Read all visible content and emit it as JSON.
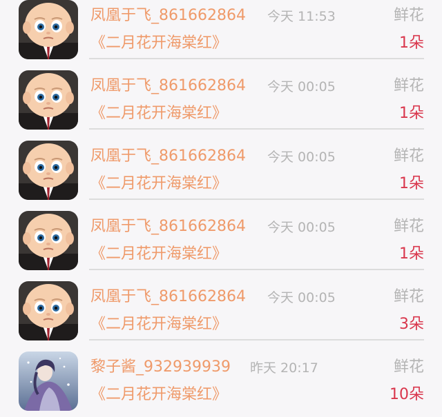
{
  "records": [
    {
      "avatar": "boss-baby-avatar",
      "user": "凤凰于飞_861662864",
      "time": "今天 11:53",
      "type": "鲜花",
      "gift": "《二月花开海棠红》",
      "count": "1朵"
    },
    {
      "avatar": "boss-baby-avatar",
      "user": "凤凰于飞_861662864",
      "time": "今天 00:05",
      "type": "鲜花",
      "gift": "《二月花开海棠红》",
      "count": "1朵"
    },
    {
      "avatar": "boss-baby-avatar",
      "user": "凤凰于飞_861662864",
      "time": "今天 00:05",
      "type": "鲜花",
      "gift": "《二月花开海棠红》",
      "count": "1朵"
    },
    {
      "avatar": "boss-baby-avatar",
      "user": "凤凰于飞_861662864",
      "time": "今天 00:05",
      "type": "鲜花",
      "gift": "《二月花开海棠红》",
      "count": "1朵"
    },
    {
      "avatar": "boss-baby-avatar",
      "user": "凤凰于飞_861662864",
      "time": "今天 00:05",
      "type": "鲜花",
      "gift": "《二月花开海棠红》",
      "count": "3朵"
    },
    {
      "avatar": "anime-character-avatar",
      "user": "黎子酱_932939939",
      "time": "昨天 20:17",
      "type": "鲜花",
      "gift": "《二月花开海棠红》",
      "count": "10朵"
    }
  ],
  "colors": {
    "name": "#ef9a6a",
    "muted": "#b4b4b4",
    "count": "#d9364c",
    "background": "#f7f6f8"
  }
}
